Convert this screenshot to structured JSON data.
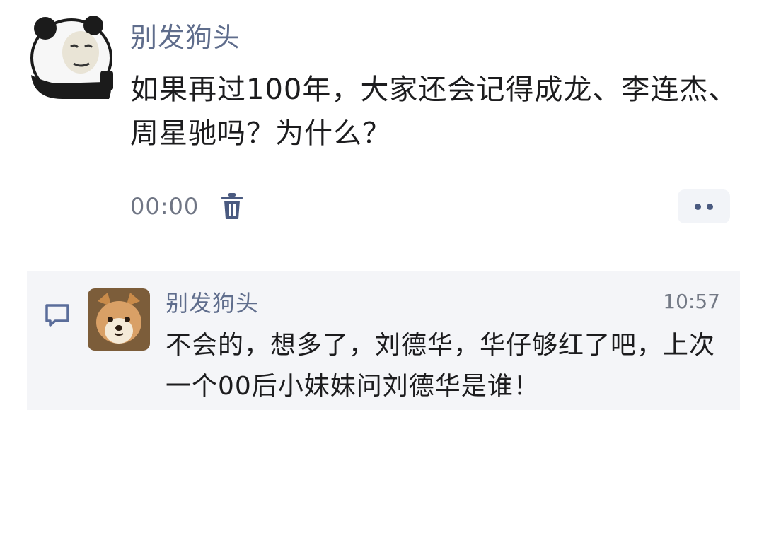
{
  "post": {
    "author": "别发狗头",
    "content": "如果再过100年，大家还会记得成龙、李连杰、周星驰吗？为什么？",
    "time": "00:00",
    "avatar_icon": "panda-meme-avatar",
    "delete_icon": "trash-icon",
    "more_icon": "more-dots-icon"
  },
  "reply": {
    "author": "别发狗头",
    "time": "10:57",
    "content": "不会的，想多了，刘德华，华仔够红了吧，上次一个00后小妹妹问刘德华是谁！",
    "avatar_icon": "shiba-dog-avatar",
    "comment_icon": "comment-bubble-icon"
  },
  "colors": {
    "name_blue": "#5f6d8c",
    "text": "#1c1c1e",
    "reply_background": "#f4f5f8",
    "icon_blue": "#4a5a80"
  }
}
